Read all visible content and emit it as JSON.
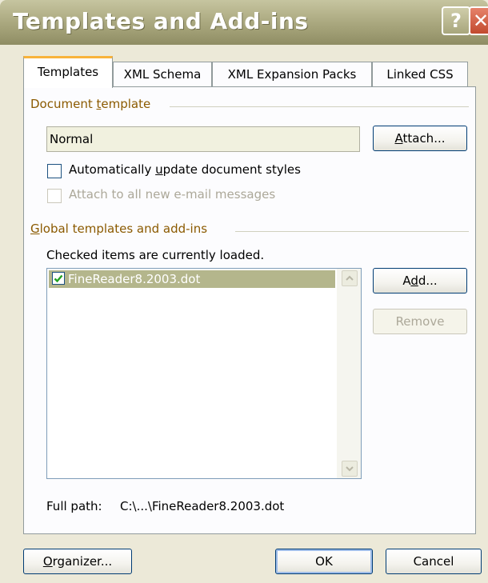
{
  "window": {
    "title": "Templates and Add-ins",
    "help_glyph": "?",
    "close_glyph": "✕"
  },
  "tabs": [
    {
      "label": "Templates",
      "active": true
    },
    {
      "label": "XML Schema",
      "active": false
    },
    {
      "label": "XML Expansion Packs",
      "active": false
    },
    {
      "label": "Linked CSS",
      "active": false
    }
  ],
  "document_template": {
    "group_label_pre": "Document ",
    "group_label_key": "t",
    "group_label_post": "emplate",
    "value": "Normal",
    "attach_key": "A",
    "attach_rest": "ttach...",
    "auto_update": {
      "label_pre": "Automatically ",
      "label_key": "u",
      "label_post": "pdate document styles",
      "checked": false,
      "enabled": true
    },
    "attach_all": {
      "label": "Attach to all new e-mail messages",
      "checked": false,
      "enabled": false
    }
  },
  "global_templates": {
    "group_label_key": "G",
    "group_label_rest": "lobal templates and add-ins",
    "note": "Checked items are currently loaded.",
    "items": [
      {
        "label": "FineReader8.2003.dot",
        "checked": true,
        "selected": true
      }
    ],
    "add_pre": "A",
    "add_key": "d",
    "add_post": "d...",
    "remove_label": "Remove"
  },
  "full_path": {
    "label": "Full path:",
    "value": "C:\\...\\FineReader8.2003.dot"
  },
  "footer": {
    "organizer_key": "O",
    "organizer_rest": "rganizer...",
    "ok_label": "OK",
    "cancel_label": "Cancel"
  },
  "colors": {
    "dialog_bg": "#ece9d8",
    "titlebar": "#a9a77d",
    "active_tab_accent": "#f8b33b",
    "group_label": "#8b5a00",
    "selection": "#b4b68c"
  }
}
